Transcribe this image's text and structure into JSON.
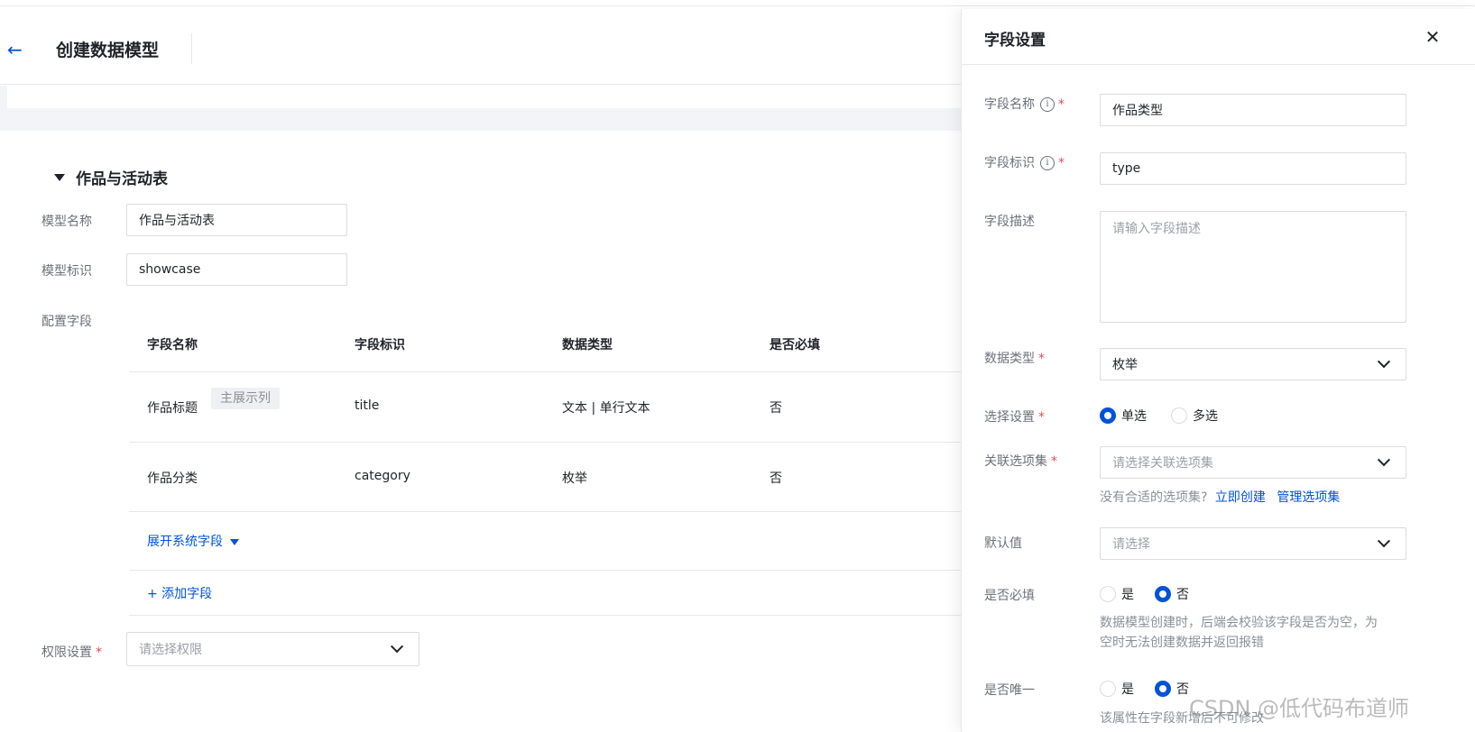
{
  "header": {
    "title": "创建数据模型"
  },
  "section": {
    "title": "作品与活动表"
  },
  "form": {
    "model_name_label": "模型名称",
    "model_name_value": "作品与活动表",
    "model_id_label": "模型标识",
    "model_id_value": "showcase",
    "fields_label": "配置字段",
    "permission_label": "权限设置",
    "permission_required": "*",
    "permission_placeholder": "请选择权限"
  },
  "table": {
    "headers": [
      "字段名称",
      "字段标识",
      "数据类型",
      "是否必填"
    ],
    "rows": [
      {
        "name": "作品标题",
        "tag": "主展示列",
        "id": "title",
        "type": "文本 | 单行文本",
        "required": "否"
      },
      {
        "name": "作品分类",
        "id": "category",
        "type": "枚举",
        "required": "否"
      }
    ],
    "expand_system_fields": "展开系统字段",
    "add_field": "+ 添加字段"
  },
  "drawer": {
    "title": "字段设置",
    "field_name_label": "字段名称",
    "field_name_value": "作品类型",
    "field_id_label": "字段标识",
    "field_id_value": "type",
    "field_desc_label": "字段描述",
    "field_desc_placeholder": "请输入字段描述",
    "data_type_label": "数据类型",
    "data_type_value": "枚举",
    "select_setting_label": "选择设置",
    "single_label": "单选",
    "multi_label": "多选",
    "option_set_label": "关联选项集",
    "option_set_placeholder": "请选择关联选项集",
    "option_set_help": "没有合适的选项集?",
    "create_now": "立即创建",
    "manage_sets": "管理选项集",
    "default_label": "默认值",
    "default_placeholder": "请选择",
    "required_label": "是否必填",
    "yes": "是",
    "no": "否",
    "required_help_1": "数据模型创建时，后端会校验该字段是否为空，为",
    "required_help_2": "空时无法创建数据并返回报错",
    "unique_label": "是否唯一",
    "unique_help": "该属性在字段新增后不可修改",
    "star": "*"
  },
  "watermark": "CSDN @低代码布道师",
  "colors": {
    "accent": "#0052d9",
    "required": "#e34d59"
  }
}
